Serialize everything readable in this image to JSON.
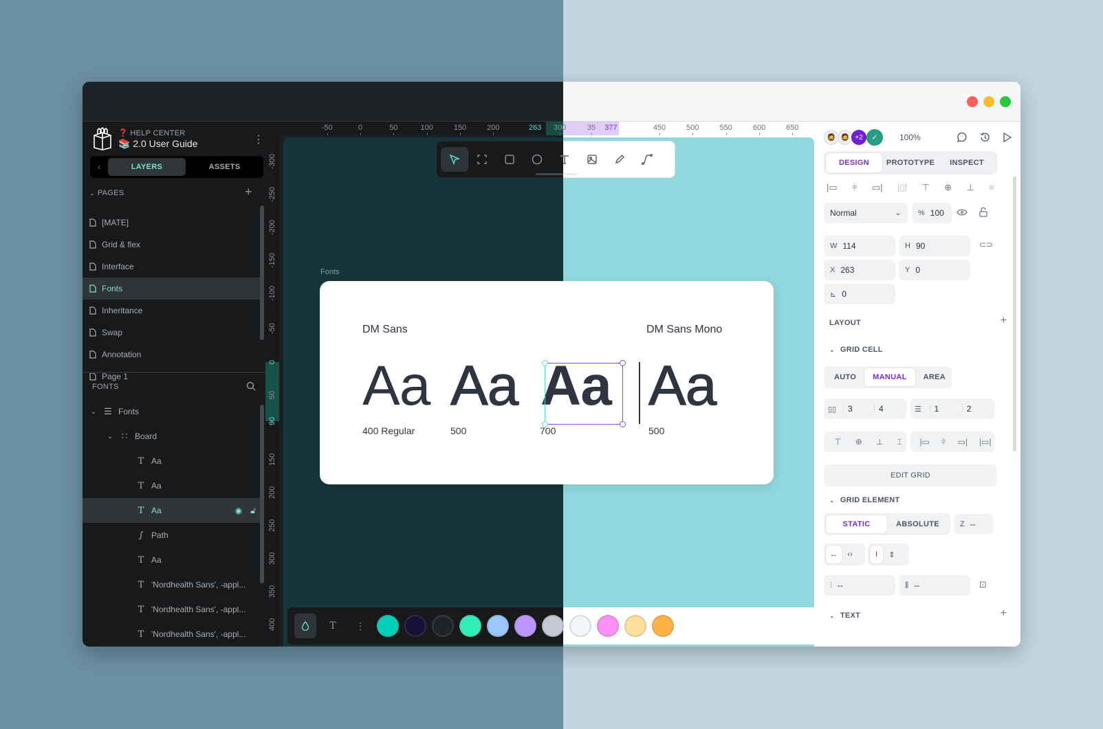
{
  "project": {
    "team": "❓ HELP CENTER",
    "name": "📚 2.0 User Guide"
  },
  "sidebar": {
    "tabs": [
      {
        "label": "LAYERS",
        "active": true
      },
      {
        "label": "ASSETS",
        "active": false
      }
    ],
    "pages_header": "PAGES",
    "pages": [
      {
        "label": "[MATE]"
      },
      {
        "label": "Grid & flex"
      },
      {
        "label": "Interface"
      },
      {
        "label": "Fonts",
        "active": true
      },
      {
        "label": "Inheritance"
      },
      {
        "label": "Swap"
      },
      {
        "label": "Annotation"
      },
      {
        "label": "Page 1"
      }
    ],
    "layers_header": "FONTS",
    "layers": [
      {
        "label": "Fonts",
        "icon": "board-icon",
        "depth": 0,
        "expanded": true
      },
      {
        "label": "Board",
        "icon": "grid-icon",
        "depth": 1,
        "expanded": true
      },
      {
        "label": "Aa",
        "icon": "text-icon",
        "depth": 2
      },
      {
        "label": "Aa",
        "icon": "text-icon",
        "depth": 2
      },
      {
        "label": "Aa",
        "icon": "text-icon",
        "depth": 2,
        "selected": true
      },
      {
        "label": "Path",
        "icon": "path-icon",
        "depth": 2
      },
      {
        "label": "Aa",
        "icon": "text-icon",
        "depth": 2
      },
      {
        "label": "'Nordhealth Sans', -appl...",
        "icon": "text-icon",
        "depth": 2
      },
      {
        "label": "'Nordhealth Sans', -appl...",
        "icon": "text-icon",
        "depth": 2
      },
      {
        "label": "'Nordhealth Sans', -appl...",
        "icon": "text-icon",
        "depth": 2
      }
    ]
  },
  "rulers": {
    "horizontal": [
      "-50",
      "0",
      "50",
      "100",
      "150",
      "200",
      "263",
      "300",
      "35",
      "377",
      "450",
      "500",
      "550",
      "600",
      "650"
    ],
    "vertical": [
      "-300",
      "-250",
      "-200",
      "-150",
      "-100",
      "-50",
      "0",
      "50",
      "90",
      "150",
      "200",
      "250",
      "300",
      "350",
      "400"
    ]
  },
  "toolbar": {
    "tools": [
      {
        "name": "move-tool",
        "active": true
      },
      {
        "name": "board-tool"
      },
      {
        "name": "rectangle-tool"
      },
      {
        "name": "ellipse-tool"
      },
      {
        "name": "text-tool"
      },
      {
        "name": "image-tool"
      },
      {
        "name": "pencil-tool"
      },
      {
        "name": "path-tool"
      }
    ]
  },
  "canvas": {
    "board_label": "Fonts",
    "families": [
      "DM Sans",
      "DM Sans Mono"
    ],
    "samples": [
      {
        "glyph": "Aa",
        "weight_label": "400 Regular"
      },
      {
        "glyph": "Aa",
        "weight_label": "500"
      },
      {
        "glyph": "Aa",
        "weight_label": "700",
        "selected": true
      },
      {
        "glyph": "Aa",
        "weight_label": "500"
      }
    ]
  },
  "palette": {
    "colors": [
      "#00d1b8",
      "#151035",
      "#1f2326",
      "#31efb8",
      "#9ac7ff",
      "#bb97ff",
      "#c5c9d6",
      "#f3f6f9",
      "#ff8ef5",
      "#ffdf99",
      "#ffb342"
    ]
  },
  "design_panel": {
    "collaborators_extra": "+2",
    "zoom": "100%",
    "tabs": [
      {
        "label": "DESIGN",
        "active": true
      },
      {
        "label": "PROTOTYPE"
      },
      {
        "label": "INSPECT"
      }
    ],
    "blend_mode": "Normal",
    "opacity_label": "%",
    "opacity": "100",
    "w": "114",
    "h": "90",
    "x": "263",
    "y": "0",
    "rotation": "0",
    "labels": {
      "w": "W",
      "h": "H",
      "x": "X",
      "y": "Y"
    },
    "layout_header": "LAYOUT",
    "grid_cell_header": "GRID CELL",
    "grid_cell_modes": [
      {
        "label": "AUTO"
      },
      {
        "label": "MANUAL",
        "active": true
      },
      {
        "label": "AREA"
      }
    ],
    "col_start": "3",
    "col_end": "4",
    "row_start": "1",
    "row_end": "2",
    "edit_grid": "EDIT GRID",
    "grid_element_header": "GRID ELEMENT",
    "position_modes": [
      {
        "label": "STATIC",
        "active": true
      },
      {
        "label": "ABSOLUTE"
      }
    ],
    "z_label": "Z",
    "z_value": "--",
    "margin_v": "--",
    "margin_h": "--",
    "text_header": "TEXT"
  },
  "colors": {
    "accent_teal": "#5dd8cc",
    "accent_purple": "#7b2fd6",
    "selection": "#8e44ec",
    "close": "#ff5f57",
    "minimize": "#febc2e",
    "maximize": "#28c840"
  }
}
